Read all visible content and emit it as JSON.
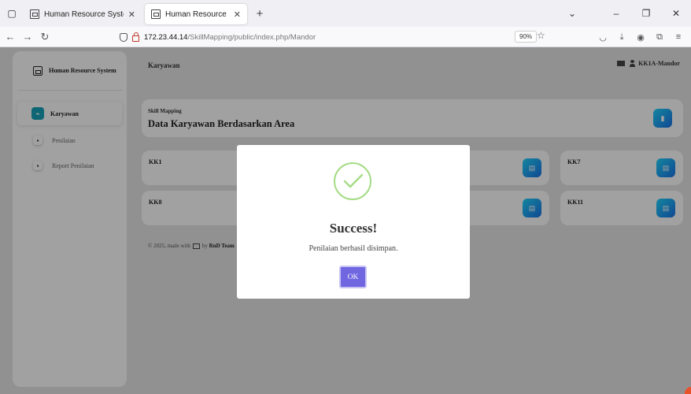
{
  "browser": {
    "tabs": [
      {
        "title": "Human Resource System",
        "active": false
      },
      {
        "title": "Human Resource System",
        "active": true
      }
    ],
    "new_tab_label": "+",
    "url_host": "172.23.44.14",
    "url_path": "/SkillMapping/public/index.php/Mandor",
    "zoom": "90%",
    "icons": {
      "tab_list": "tab-list-icon",
      "back": "back-arrow-icon",
      "forward": "forward-arrow-icon",
      "reload": "reload-icon",
      "bookmark": "star-icon",
      "pocket": "pocket-icon",
      "download": "download-icon",
      "account": "account-icon",
      "extensions": "extensions-icon",
      "menu": "hamburger-menu-icon"
    }
  },
  "sidebar": {
    "brand": "Human Resource System",
    "items": [
      {
        "label": "Karyawan",
        "active": true
      },
      {
        "label": "Penilaian",
        "active": false
      },
      {
        "label": "Report Penilaian",
        "active": false
      }
    ]
  },
  "main": {
    "page_heading": "Karyawan",
    "user_label": "KK1A-Mandor",
    "header": {
      "subtitle": "Skill Mapping",
      "title": "Data Karyawan Berdasarkan Area"
    },
    "areas": [
      "KK1",
      "KK7",
      "KK8",
      "KK11"
    ],
    "footer": {
      "prefix": "© 2025, made with",
      "by": "by",
      "team": "RnD Team"
    }
  },
  "modal": {
    "title": "Success!",
    "message": "Penilaian berhasil disimpan.",
    "ok_label": "OK"
  },
  "colors": {
    "ok_button": "#7066e0",
    "success_green": "#a5dc86",
    "sidebar_active_icon": "#17a2b8",
    "card_button_from": "#21d4fd",
    "card_button_to": "#1a73e8"
  }
}
